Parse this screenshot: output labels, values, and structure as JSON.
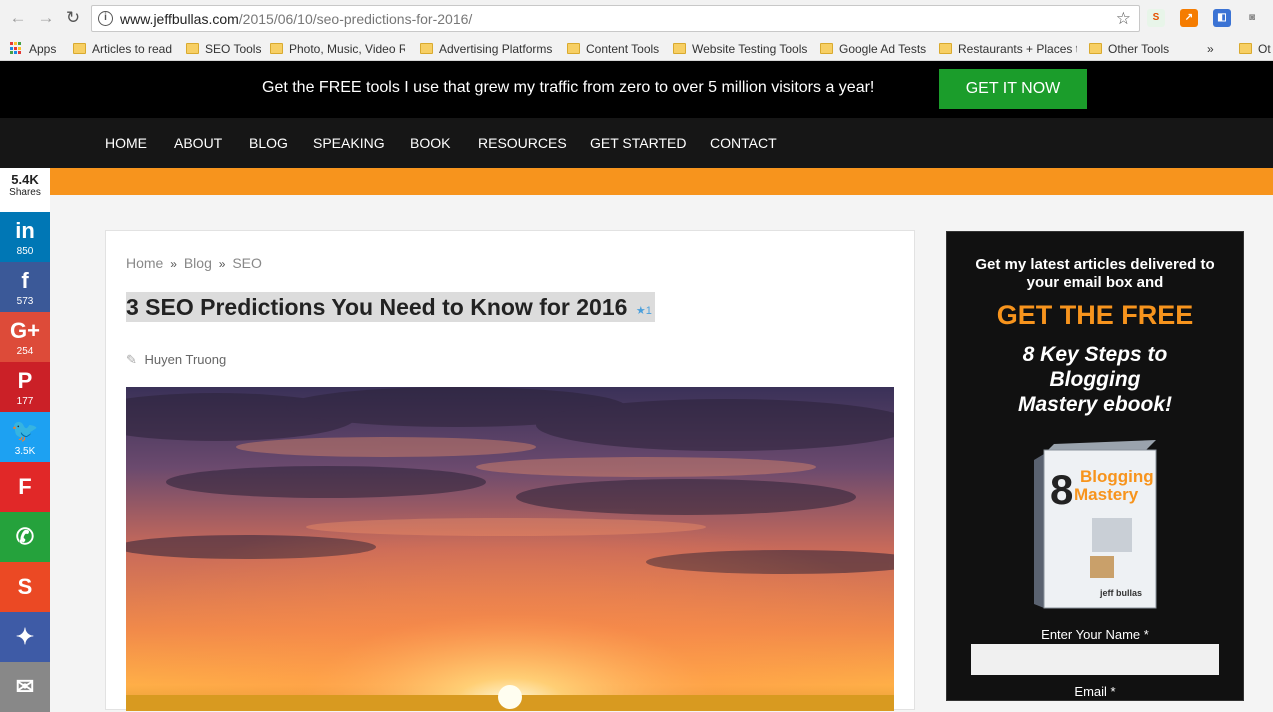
{
  "browser": {
    "url_domain": "www.jeffbullas.com",
    "url_path": "/2015/06/10/seo-predictions-for-2016/",
    "bookmarks": [
      {
        "label": "Apps"
      },
      {
        "label": "Articles to read"
      },
      {
        "label": "SEO Tools"
      },
      {
        "label": "Photo, Music, Video R"
      },
      {
        "label": "Advertising Platforms"
      },
      {
        "label": "Content Tools"
      },
      {
        "label": "Website Testing Tools"
      },
      {
        "label": "Google Ad Tests"
      },
      {
        "label": "Restaurants + Places t"
      },
      {
        "label": "Other Tools"
      },
      {
        "label": "»"
      },
      {
        "label": "Ot"
      }
    ]
  },
  "promo": {
    "text": "Get the FREE tools I use that grew my traffic from zero to over 5 million visitors a year!",
    "button": "GET IT NOW",
    "button_color": "#1b9d2b"
  },
  "nav": {
    "items": [
      "HOME",
      "ABOUT",
      "BLOG",
      "SPEAKING",
      "BOOK",
      "RESOURCES",
      "GET STARTED",
      "CONTACT"
    ]
  },
  "article": {
    "breadcrumb": [
      "Home",
      "Blog",
      "SEO"
    ],
    "breadcrumb_sep": "»",
    "title": "3 SEO Predictions You Need to Know for 2016",
    "title_badge": "★1",
    "author": "Huyen Truong"
  },
  "sidebar": {
    "headline": "Get my latest articles delivered to your email box and",
    "free": "GET THE FREE",
    "ebook": "8 Key Steps to Blogging Mastery ebook!",
    "book_title_big": "8",
    "book_title_a": "Blogging",
    "book_title_b": "Mastery",
    "book_author": "jeff bullas",
    "name_label": "Enter Your Name *",
    "email_label": "Email *",
    "accent": "#f7941d"
  },
  "share": {
    "total": "5.4K",
    "total_label": "Shares",
    "buttons": [
      {
        "network": "linkedin",
        "icon": "in",
        "count": "850",
        "color": "#0077b5"
      },
      {
        "network": "facebook",
        "icon": "f",
        "count": "573",
        "color": "#3b5998"
      },
      {
        "network": "google-plus",
        "icon": "G+",
        "count": "254",
        "color": "#dd4b39"
      },
      {
        "network": "pinterest",
        "icon": "P",
        "count": "177",
        "color": "#cb2027"
      },
      {
        "network": "twitter",
        "icon": "🐦",
        "count": "3.5K",
        "color": "#1da1f2"
      },
      {
        "network": "flipboard",
        "icon": "F",
        "count": "",
        "color": "#e12828"
      },
      {
        "network": "whatsapp",
        "icon": "✆",
        "count": "",
        "color": "#25a23c"
      },
      {
        "network": "stumbleupon",
        "icon": "S",
        "count": "",
        "color": "#eb4924"
      },
      {
        "network": "messenger",
        "icon": "✦",
        "count": "",
        "color": "#3e5ba6"
      },
      {
        "network": "email",
        "icon": "✉",
        "count": "",
        "color": "#888888"
      }
    ]
  }
}
